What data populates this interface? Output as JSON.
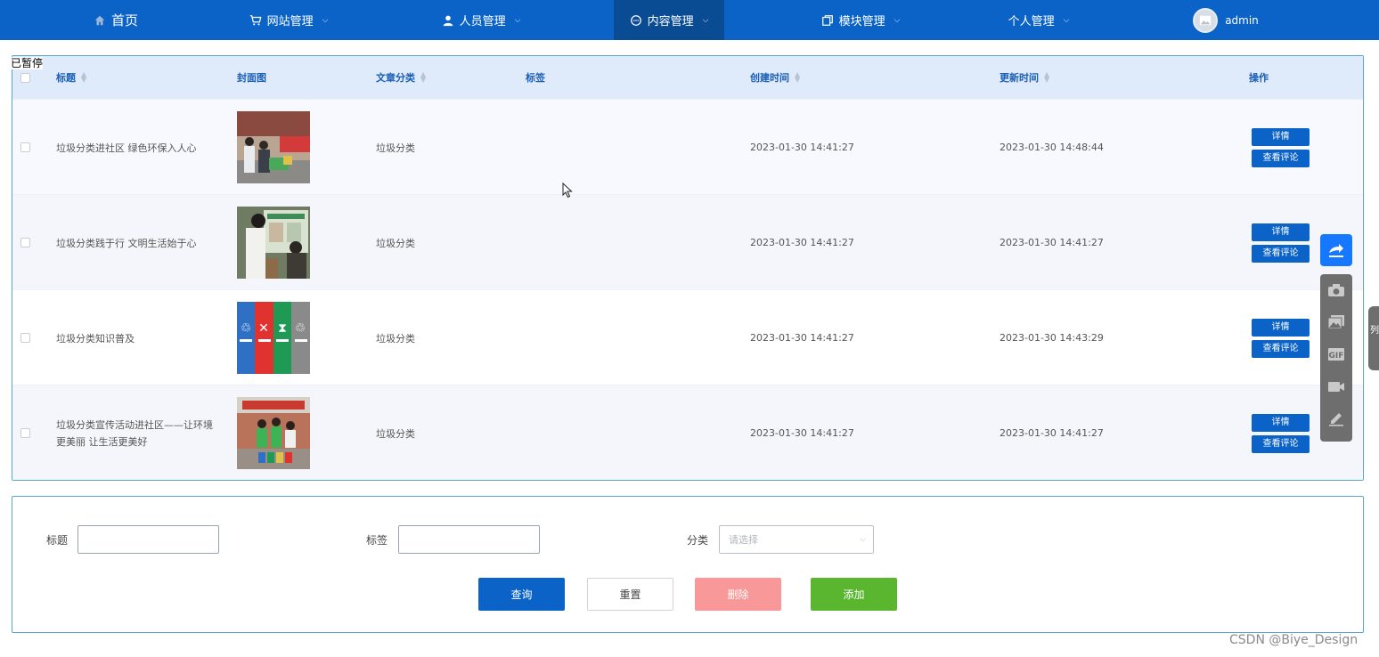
{
  "nav": {
    "home": "首页",
    "website": "网站管理",
    "people": "人员管理",
    "content": "内容管理",
    "modules": "模块管理",
    "personal": "个人管理",
    "user": "admin"
  },
  "paused_label": "已暂停",
  "table": {
    "headers": {
      "title": "标题",
      "cover": "封面图",
      "category": "文章分类",
      "tags": "标签",
      "created": "创建时间",
      "updated": "更新时间",
      "actions": "操作"
    },
    "rows": [
      {
        "title": "垃圾分类进社区 绿色环保入人心",
        "category": "垃圾分类",
        "tags": "",
        "created": "2023-01-30 14:41:27",
        "updated": "2023-01-30 14:48:44",
        "cover": "photo-community-event"
      },
      {
        "title": "垃圾分类践于行 文明生活始于心",
        "category": "垃圾分类",
        "tags": "",
        "created": "2023-01-30 14:41:27",
        "updated": "2023-01-30 14:41:27",
        "cover": "photo-bulletin-board"
      },
      {
        "title": "垃圾分类知识普及",
        "category": "垃圾分类",
        "tags": "",
        "created": "2023-01-30 14:41:27",
        "updated": "2023-01-30 14:43:29",
        "cover": "photo-sorting-bins"
      },
      {
        "title": "垃圾分类宣传活动进社区——让环境更美丽 让生活更美好",
        "category": "垃圾分类",
        "tags": "",
        "created": "2023-01-30 14:41:27",
        "updated": "2023-01-30 14:41:27",
        "cover": "photo-volunteers"
      }
    ],
    "detail_label": "详情",
    "comments_label": "查看评论"
  },
  "search": {
    "title_label": "标题",
    "tag_label": "标签",
    "category_label": "分类",
    "category_placeholder": "请选择",
    "query": "查询",
    "reset": "重置",
    "delete": "删除",
    "add": "添加"
  },
  "side_tab_text": "列",
  "watermark": "CSDN @Biye_Design",
  "colors": {
    "nav": "#0b63c8",
    "nav_active": "#0a4c93",
    "primary": "#0b63c8",
    "danger": "#f89898",
    "success": "#5ab62f"
  }
}
